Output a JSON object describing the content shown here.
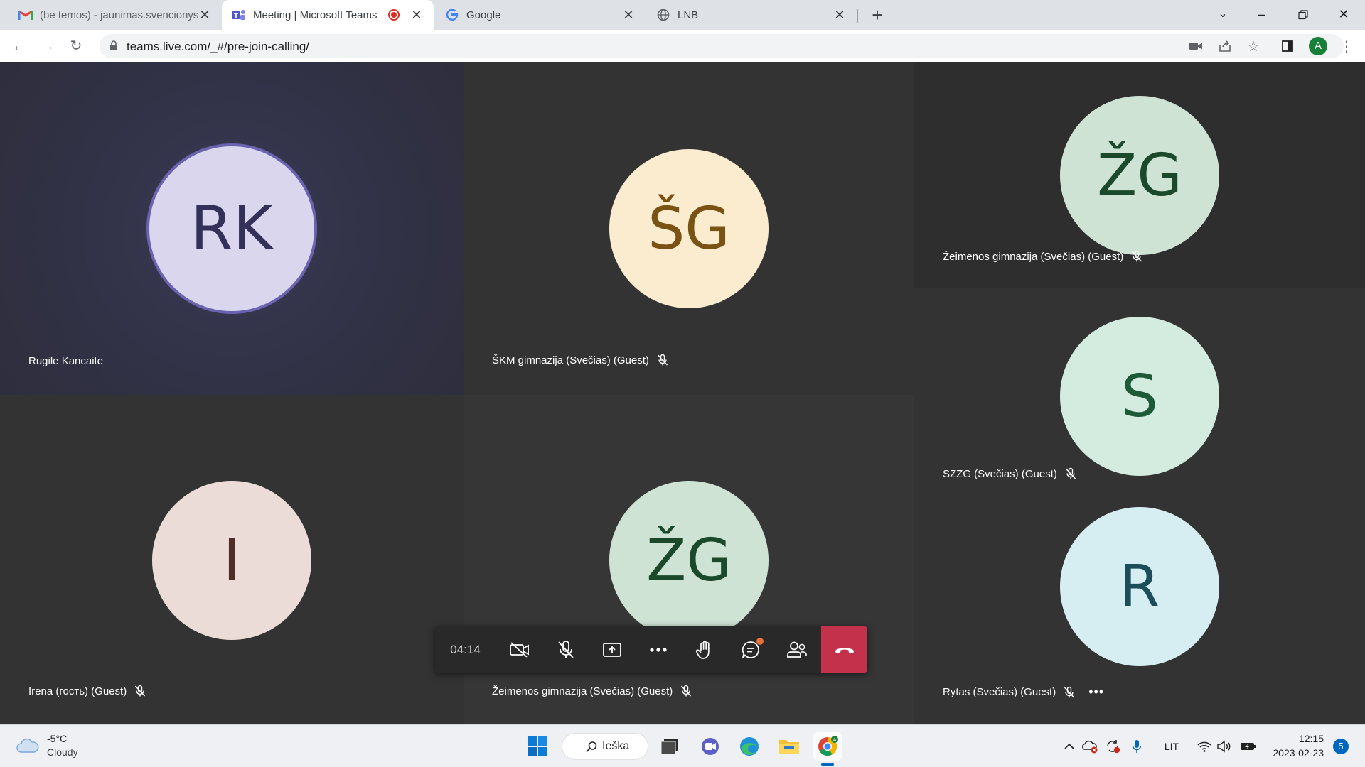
{
  "browser": {
    "tabs": [
      {
        "title": "(be temos) - jaunimas.svencionys",
        "icon": "gmail-icon",
        "active": false
      },
      {
        "title": "Meeting | Microsoft Teams",
        "icon": "teams-icon",
        "active": true,
        "recording": true
      },
      {
        "title": "Google",
        "icon": "google-icon",
        "active": false
      },
      {
        "title": "LNB",
        "icon": "globe-icon",
        "active": false
      }
    ],
    "url": "teams.live.com/_#/pre-join-calling/",
    "profile_initial": "A"
  },
  "meeting": {
    "timer": "04:14",
    "participants": [
      {
        "initials": "RK",
        "name": "Rugile Kancaite",
        "muted": false,
        "speaking": true,
        "avatar_bg": "#d9d6ee",
        "avatar_fg": "#33305a",
        "ring": "#6b63b0"
      },
      {
        "initials": "ŠG",
        "name": "ŠKM gimnazija (Svečias) (Guest)",
        "muted": true,
        "avatar_bg": "#fbecd0",
        "avatar_fg": "#7a5314"
      },
      {
        "initials": "ŽG",
        "name": "Žeimenos gimnazija (Svečias) (Guest)",
        "muted": true,
        "avatar_bg": "#cfe3d5",
        "avatar_fg": "#1a4a2b"
      },
      {
        "initials": "S",
        "name": "SZZG (Svečias) (Guest)",
        "muted": true,
        "avatar_bg": "#d4ece0",
        "avatar_fg": "#1c5a38"
      },
      {
        "initials": "I",
        "name": "Irena (гость) (Guest)",
        "muted": true,
        "avatar_bg": "#ecdcd8",
        "avatar_fg": "#4e2e26"
      },
      {
        "initials": "ŽG",
        "name": "Žeimenos gimnazija (Svečias) (Guest)",
        "muted": true,
        "avatar_bg": "#cfe3d5",
        "avatar_fg": "#1a4a2b"
      },
      {
        "initials": "R",
        "name": "Rytas (Svečias) (Guest)",
        "muted": true,
        "avatar_bg": "#d6eef2",
        "avatar_fg": "#1c4e5a"
      }
    ],
    "controls": [
      "camera-off-icon",
      "mic-off-icon",
      "share-screen-icon",
      "more-icon",
      "raise-hand-icon",
      "chat-icon",
      "people-icon",
      "hang-up-icon"
    ],
    "hangup_color": "#c4314b"
  },
  "taskbar": {
    "weather": {
      "temp": "-5°C",
      "condition": "Cloudy"
    },
    "search_label": "Ieška",
    "language": "LIT",
    "time": "12:15",
    "date": "2023-02-23",
    "notification_count": "5"
  }
}
